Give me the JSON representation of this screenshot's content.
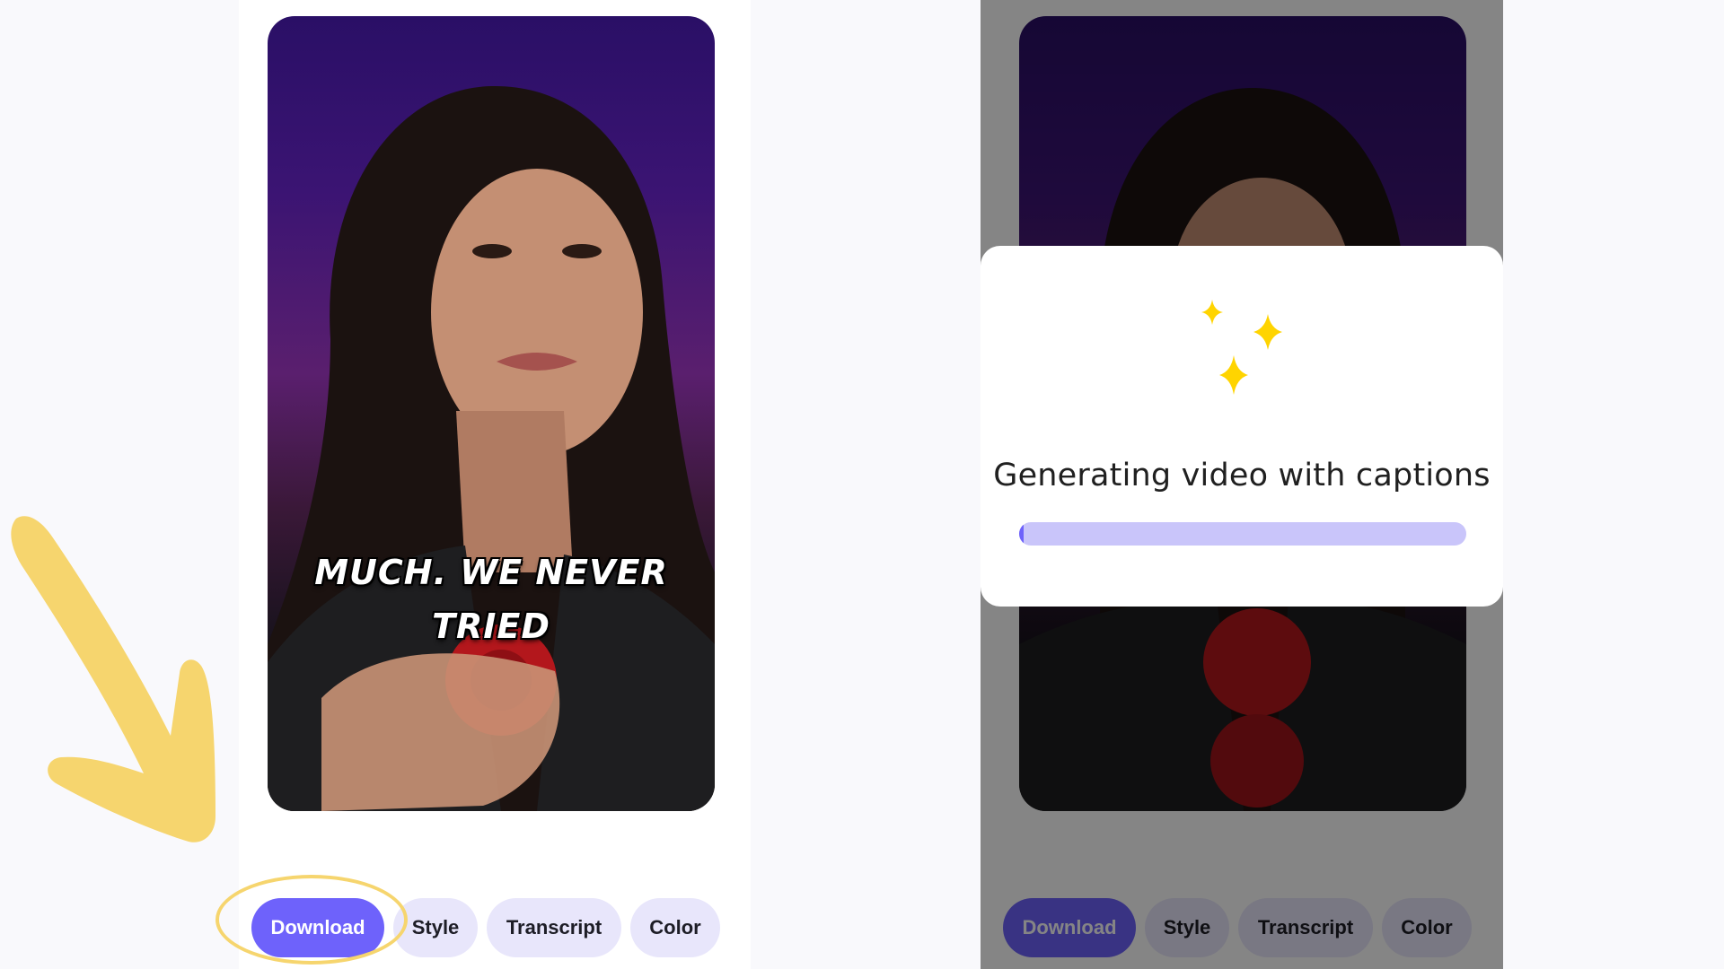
{
  "left_panel": {
    "caption_lines": [
      "MUCH. WE NEVER",
      "TRIED"
    ],
    "toolbar": {
      "download_label": "Download",
      "style_label": "Style",
      "transcript_label": "Transcript",
      "color_label": "Color"
    }
  },
  "right_panel": {
    "modal": {
      "title": "Generating video with captions",
      "progress": 0.01
    },
    "toolbar": {
      "download_label": "Download",
      "style_label": "Style",
      "transcript_label": "Transcript",
      "color_label": "Color"
    }
  },
  "annotations": {
    "arrow_icon": "arrow-down-right-icon",
    "highlight": "download-button-circle"
  },
  "colors": {
    "accent": "#6e62fb",
    "button_bg": "#e8e6fb",
    "progress_track": "#c9c5fa",
    "annotation": "#f6d56e",
    "sparkle": "#ffd400"
  }
}
